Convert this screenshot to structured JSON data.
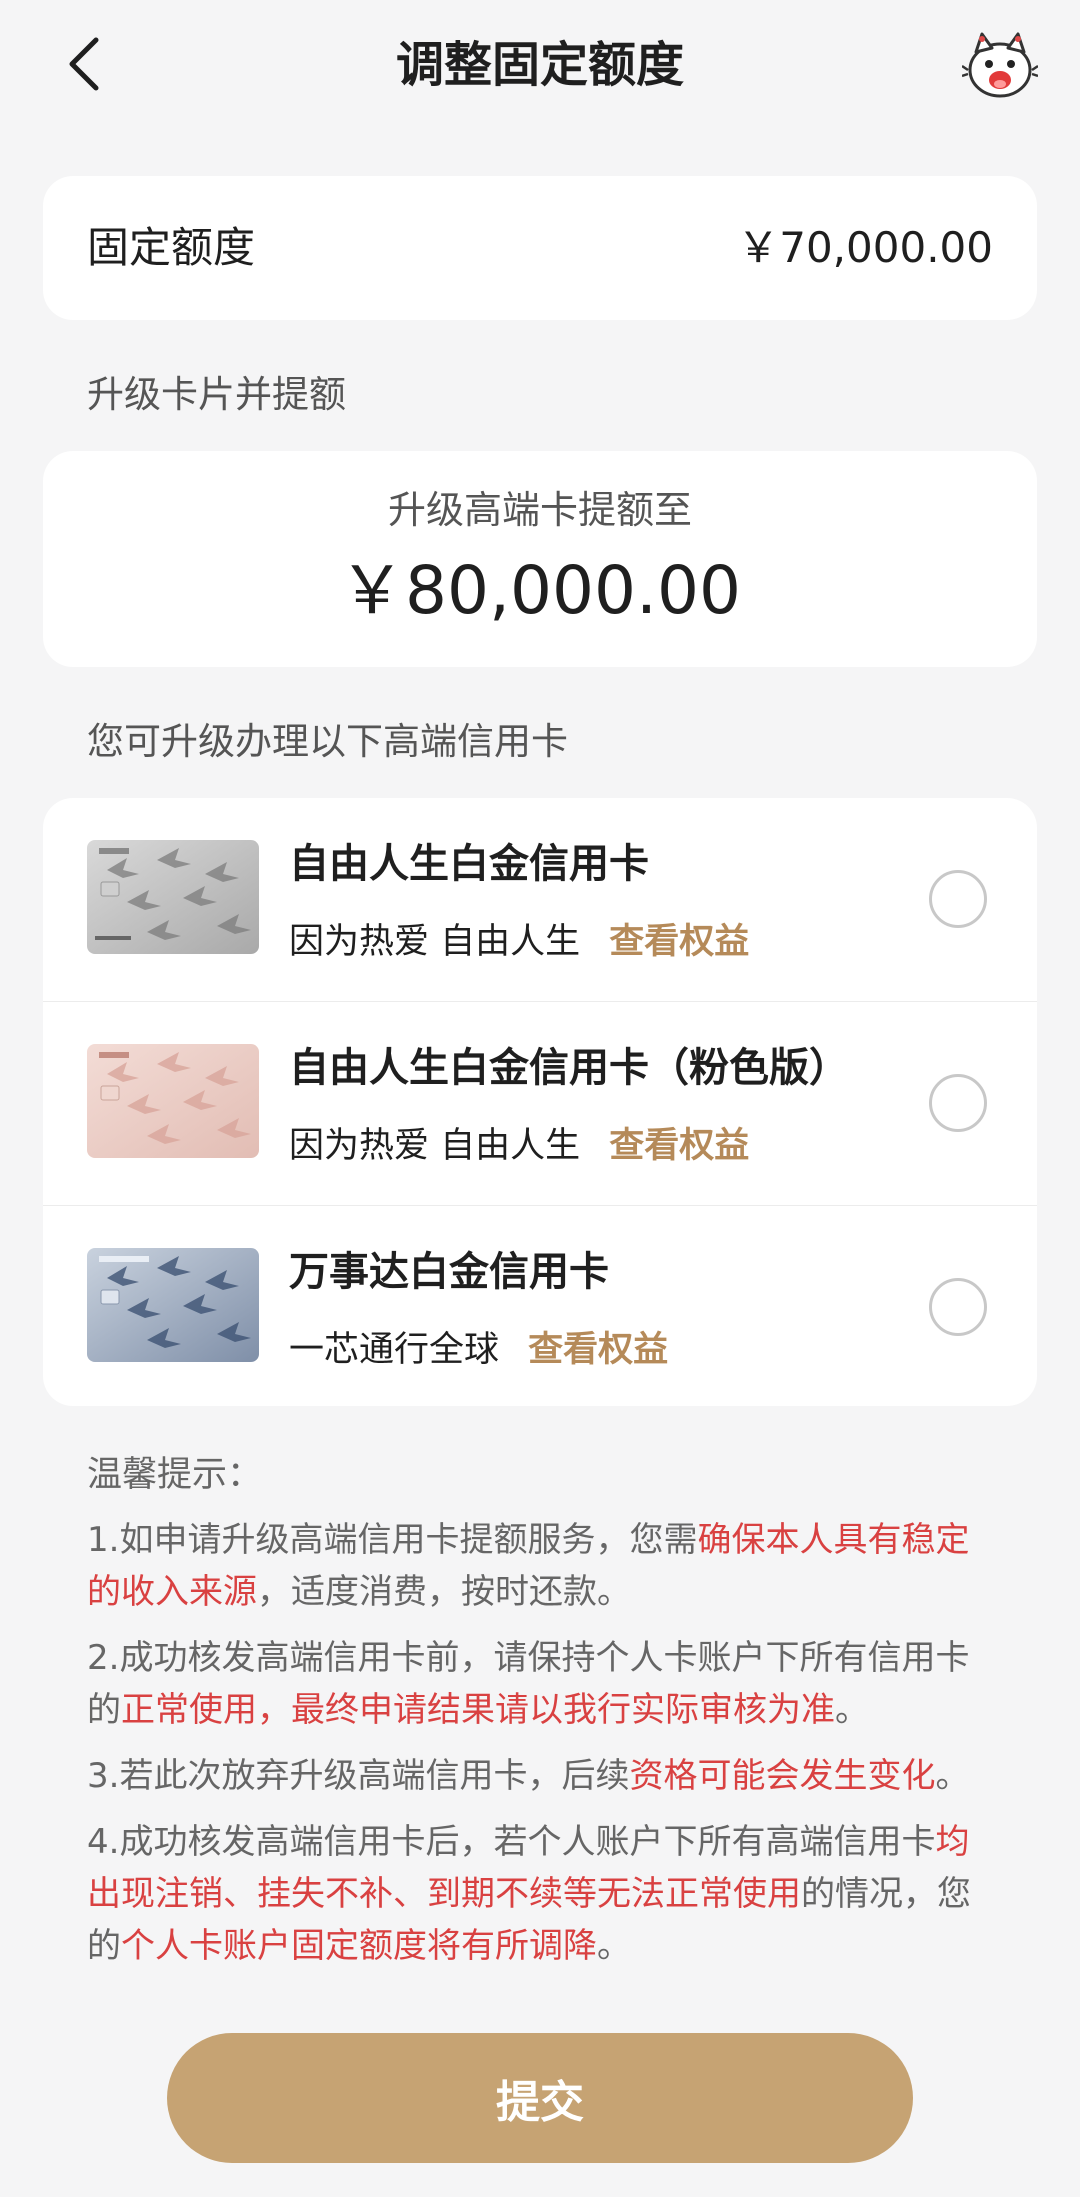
{
  "header": {
    "title": "调整固定额度"
  },
  "limit": {
    "label": "固定额度",
    "value": "￥70,000.00"
  },
  "upgrade": {
    "section_title": "升级卡片并提额",
    "subtitle": "升级高端卡提额至",
    "amount": "￥80,000.00"
  },
  "cards": {
    "section_title": "您可升级办理以下高端信用卡",
    "items": [
      {
        "name": "自由人生白金信用卡",
        "tagline": "因为热爱 自由人生",
        "link": "查看权益",
        "theme": "silver",
        "selected": false
      },
      {
        "name": "自由人生白金信用卡（粉色版）",
        "tagline": "因为热爱 自由人生",
        "link": "查看权益",
        "theme": "pink",
        "selected": false
      },
      {
        "name": "万事达白金信用卡",
        "tagline": "一芯通行全球",
        "link": "查看权益",
        "theme": "blue",
        "selected": false
      }
    ]
  },
  "tips": {
    "title": "温馨提示：",
    "t1": {
      "a": "1.如申请升级高端信用卡提额服务，您需",
      "b": "确保本人具有稳定的收入来源",
      "c": "，适度消费，按时还款。"
    },
    "t2": {
      "a": "2.成功核发高端信用卡前，请保持个人卡账户下所有信用卡的",
      "b": "正常使用，最终申请结果请以我行实际审核为准",
      "c": "。"
    },
    "t3": {
      "a": "3.若此次放弃升级高端信用卡，后续",
      "b": "资格可能会发生变化",
      "c": "。"
    },
    "t4": {
      "a": "4.成功核发高端信用卡后，若个人账户下所有高端信用卡",
      "b": "均出现注销、挂失不补、到期不续等无法正常使用",
      "c": "的情况，您的",
      "d": "个人卡账户固定额度将有所调降",
      "e": "。"
    }
  },
  "submit_label": "提交",
  "colors": {
    "accent": "#c6a373",
    "link": "#b58a59",
    "warning": "#d94141",
    "background": "#f5f5f6"
  }
}
